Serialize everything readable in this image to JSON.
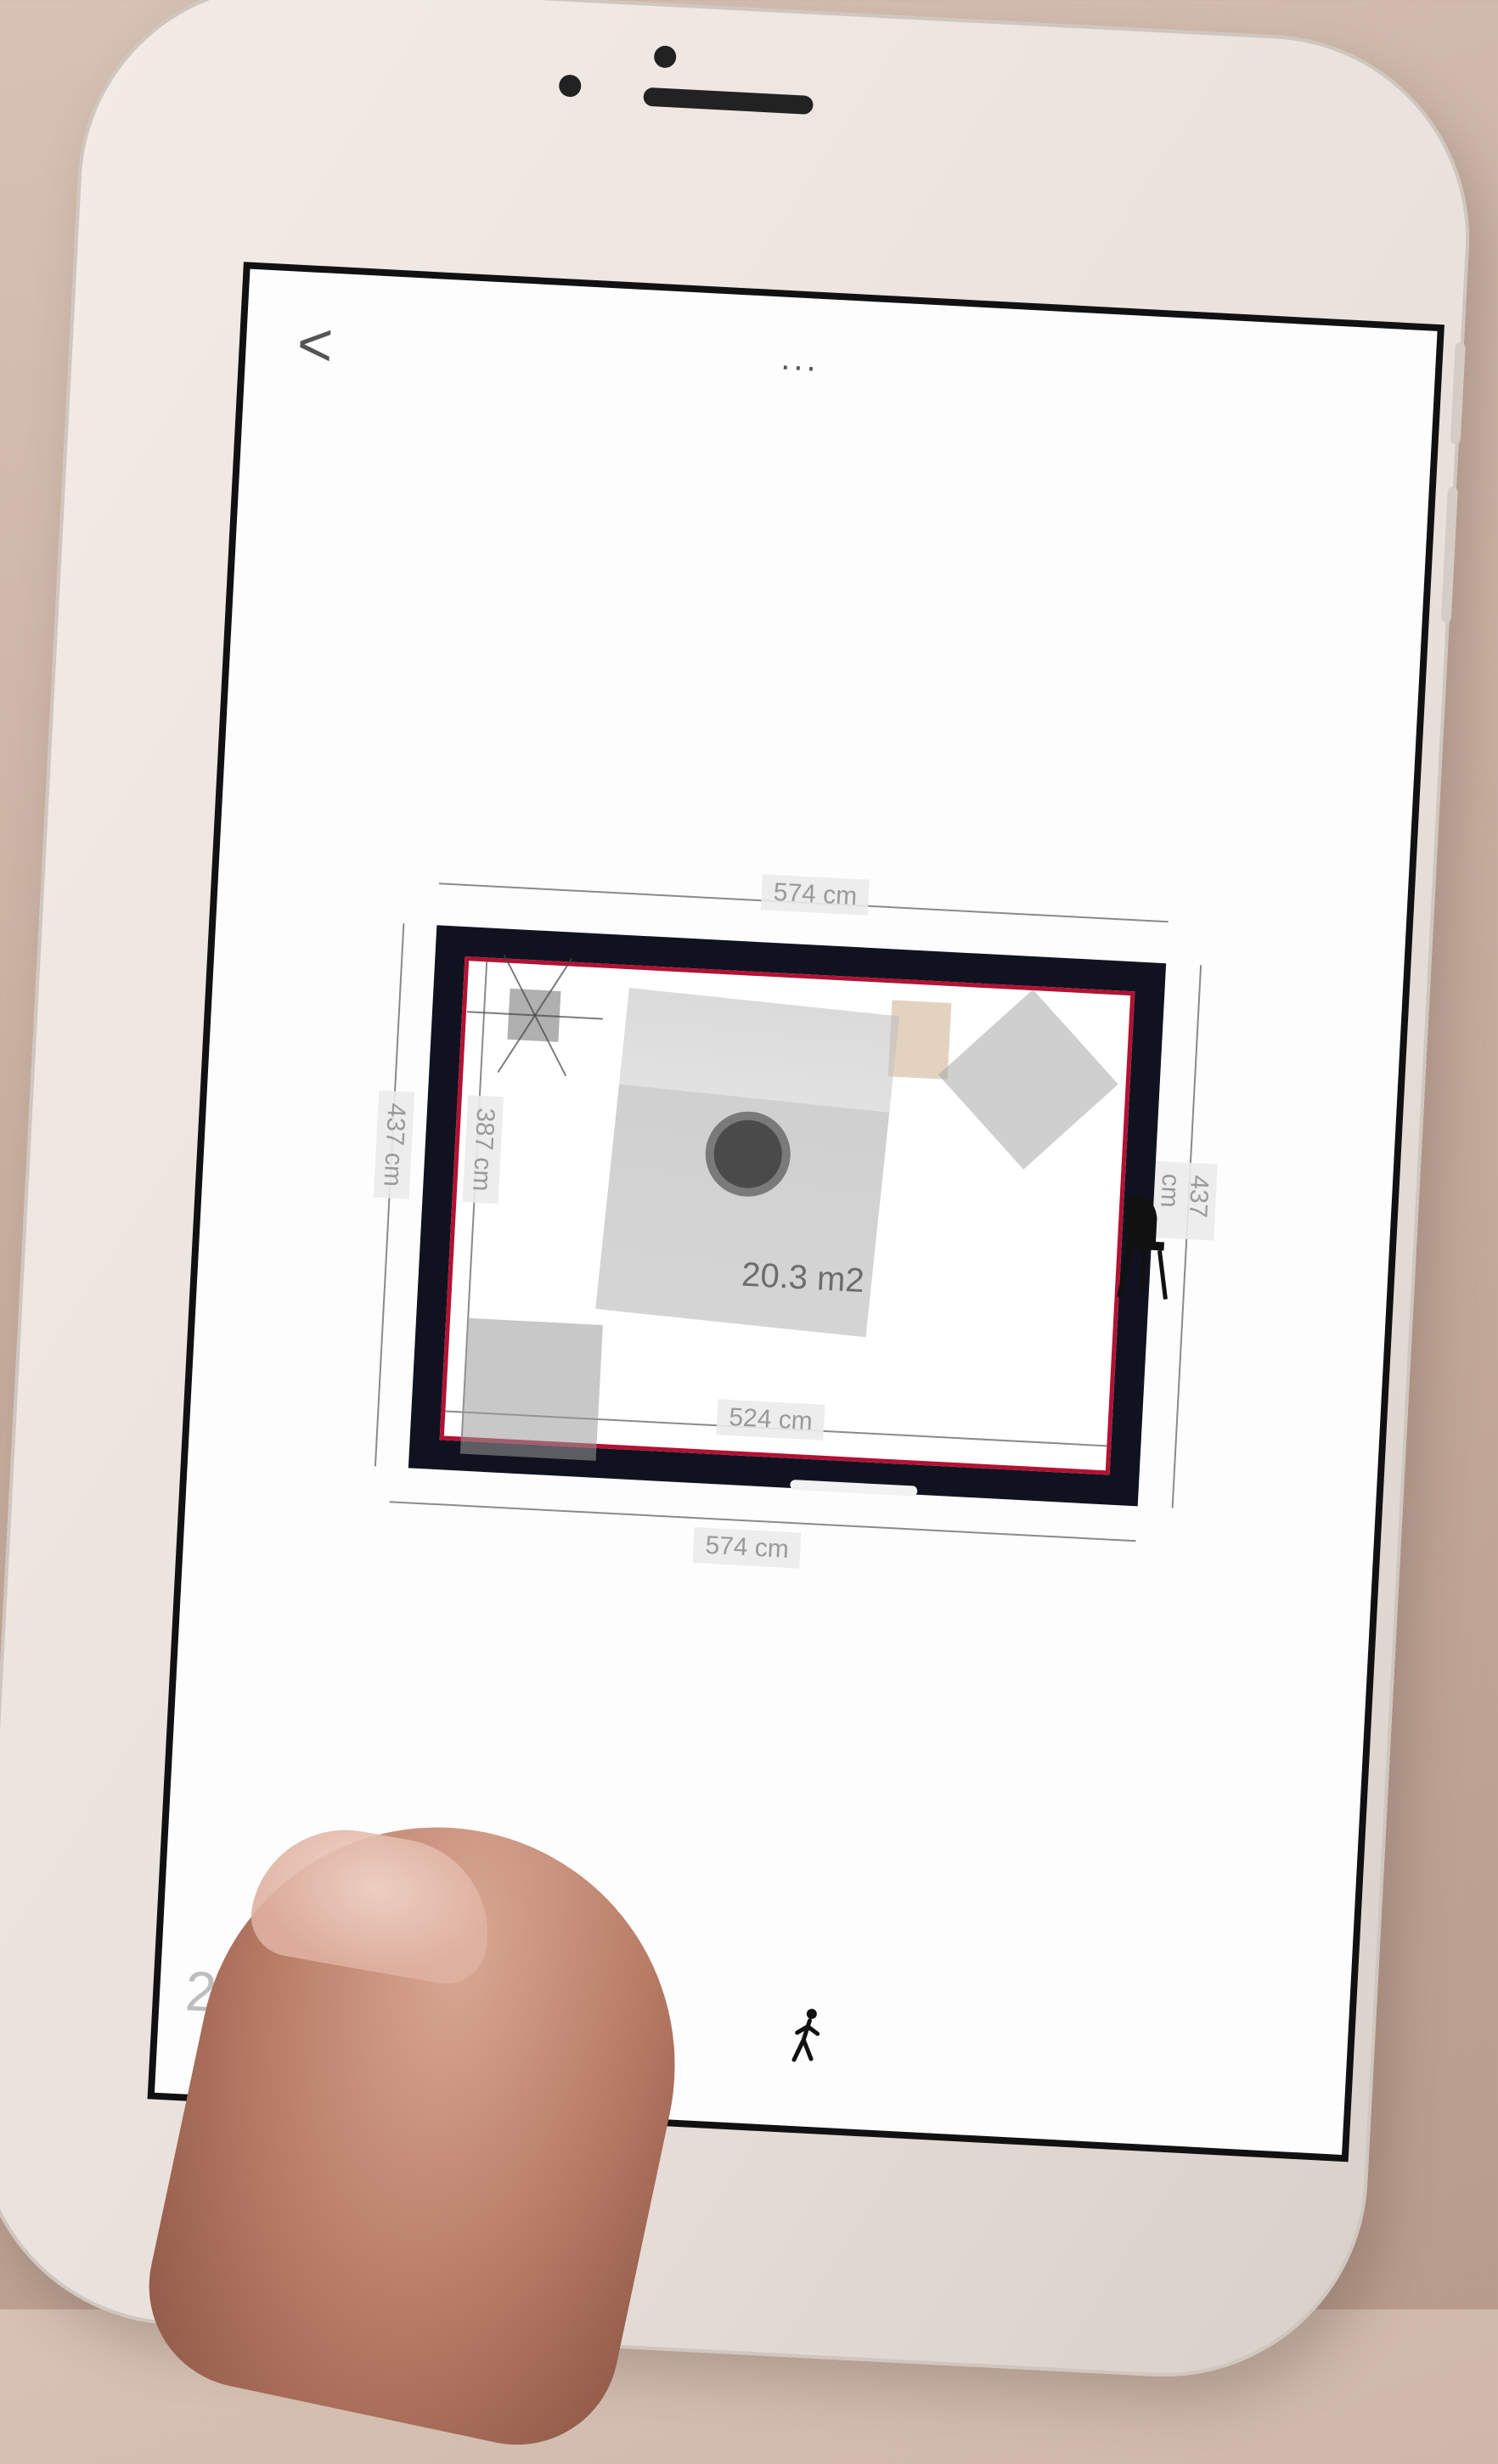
{
  "header": {
    "back_glyph": "<",
    "more_glyph": "..."
  },
  "floor_plan": {
    "top_width_label": "574 cm",
    "bottom_width_label": "574 cm",
    "inner_width_label": "524 cm",
    "left_height_label": "437 cm",
    "inner_height_label": "387 cm",
    "right_height_label": "437 cm",
    "room_area": "20.3 m2",
    "colors": {
      "wall": "#10131f",
      "accent": "#b21234"
    }
  },
  "footer": {
    "area_summary": "20.3 m",
    "walk_icon": "person-walking-icon"
  }
}
